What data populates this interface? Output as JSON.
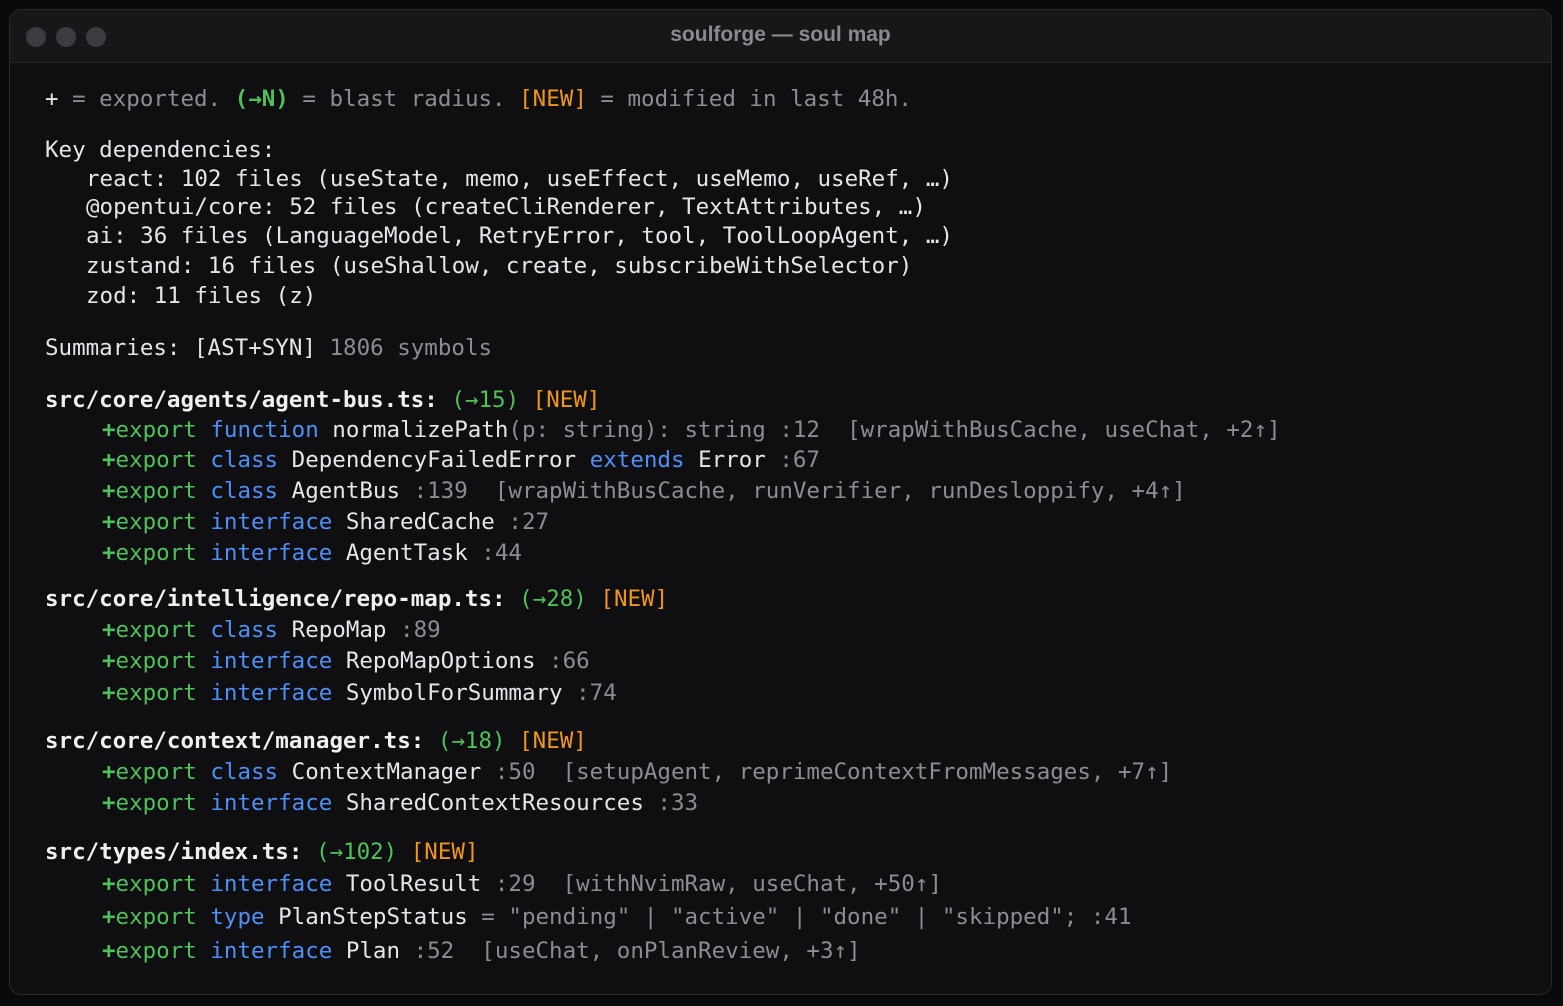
{
  "window": {
    "title": "soulforge — soul map"
  },
  "legend": {
    "plus": "+",
    "eq1": " = exported. ",
    "radius": "(→N)",
    "eq2": " = blast radius. ",
    "new": "[NEW]",
    "eq3": " = modified in last 48h."
  },
  "deps": {
    "heading": "Key dependencies:",
    "items": [
      "react: 102 files (useState, memo, useEffect, useMemo, useRef, …)",
      "@opentui/core: 52 files (createCliRenderer, TextAttributes, …)",
      "ai: 36 files (LanguageModel, RetryError, tool, ToolLoopAgent, …)",
      "zustand: 16 files (useShallow, create, subscribeWithSelector)",
      "zod: 11 files (z)"
    ]
  },
  "summaries": {
    "label": "Summaries: [AST+SYN]",
    "count": " 1806 symbols"
  },
  "files": [
    {
      "path": "src/core/agents/agent-bus.ts:",
      "radius": "(→15)",
      "tag": "[NEW]",
      "symbols": [
        {
          "plus": "+",
          "export": "export",
          "kind": "function",
          "sig": "normalizePath",
          "rest": "(p: string): string",
          "line": " :12",
          "refs": "  [wrapWithBusCache, useChat, +2↑]"
        },
        {
          "plus": "+",
          "export": "export",
          "kind": "class",
          "sig": "DependencyFailedError",
          "ext": "extends",
          "rest": "Error",
          "line": " :67",
          "refs": ""
        },
        {
          "plus": "+",
          "export": "export",
          "kind": "class",
          "sig": "AgentBus",
          "rest": "",
          "line": " :139",
          "refs": "  [wrapWithBusCache, runVerifier, runDesloppify, +4↑]"
        },
        {
          "plus": "+",
          "export": "export",
          "kind": "interface",
          "sig": "SharedCache",
          "rest": "",
          "line": " :27",
          "refs": ""
        },
        {
          "plus": "+",
          "export": "export",
          "kind": "interface",
          "sig": "AgentTask",
          "rest": "",
          "line": " :44",
          "refs": ""
        }
      ]
    },
    {
      "path": "src/core/intelligence/repo-map.ts:",
      "radius": "(→28)",
      "tag": "[NEW]",
      "symbols": [
        {
          "plus": "+",
          "export": "export",
          "kind": "class",
          "sig": "RepoMap",
          "rest": "",
          "line": " :89",
          "refs": ""
        },
        {
          "plus": "+",
          "export": "export",
          "kind": "interface",
          "sig": "RepoMapOptions",
          "rest": "",
          "line": " :66",
          "refs": ""
        },
        {
          "plus": "+",
          "export": "export",
          "kind": "interface",
          "sig": "SymbolForSummary",
          "rest": "",
          "line": " :74",
          "refs": ""
        }
      ]
    },
    {
      "path": "src/core/context/manager.ts:",
      "radius": "(→18)",
      "tag": "[NEW]",
      "symbols": [
        {
          "plus": "+",
          "export": "export",
          "kind": "class",
          "sig": "ContextManager",
          "rest": "",
          "line": " :50",
          "refs": "  [setupAgent, reprimeContextFromMessages, +7↑]"
        },
        {
          "plus": "+",
          "export": "export",
          "kind": "interface",
          "sig": "SharedContextResources",
          "rest": "",
          "line": " :33",
          "refs": ""
        }
      ]
    },
    {
      "path": "src/types/index.ts:",
      "radius": "(→102)",
      "tag": "[NEW]",
      "symbols": [
        {
          "plus": "+",
          "export": "export",
          "kind": "interface",
          "sig": "ToolResult",
          "rest": "",
          "line": " :29",
          "refs": "  [withNvimRaw, useChat, +50↑]"
        },
        {
          "plus": "+",
          "export": "export",
          "kind": "type",
          "sig": "PlanStepStatus",
          "rest": " = \"pending\" | \"active\" | \"done\" | \"skipped\";",
          "line": " :41",
          "refs": ""
        },
        {
          "plus": "+",
          "export": "export",
          "kind": "interface",
          "sig": "Plan",
          "rest": "",
          "line": " :52",
          "refs": "  [useChat, onPlanReview, +3↑]"
        }
      ]
    }
  ]
}
